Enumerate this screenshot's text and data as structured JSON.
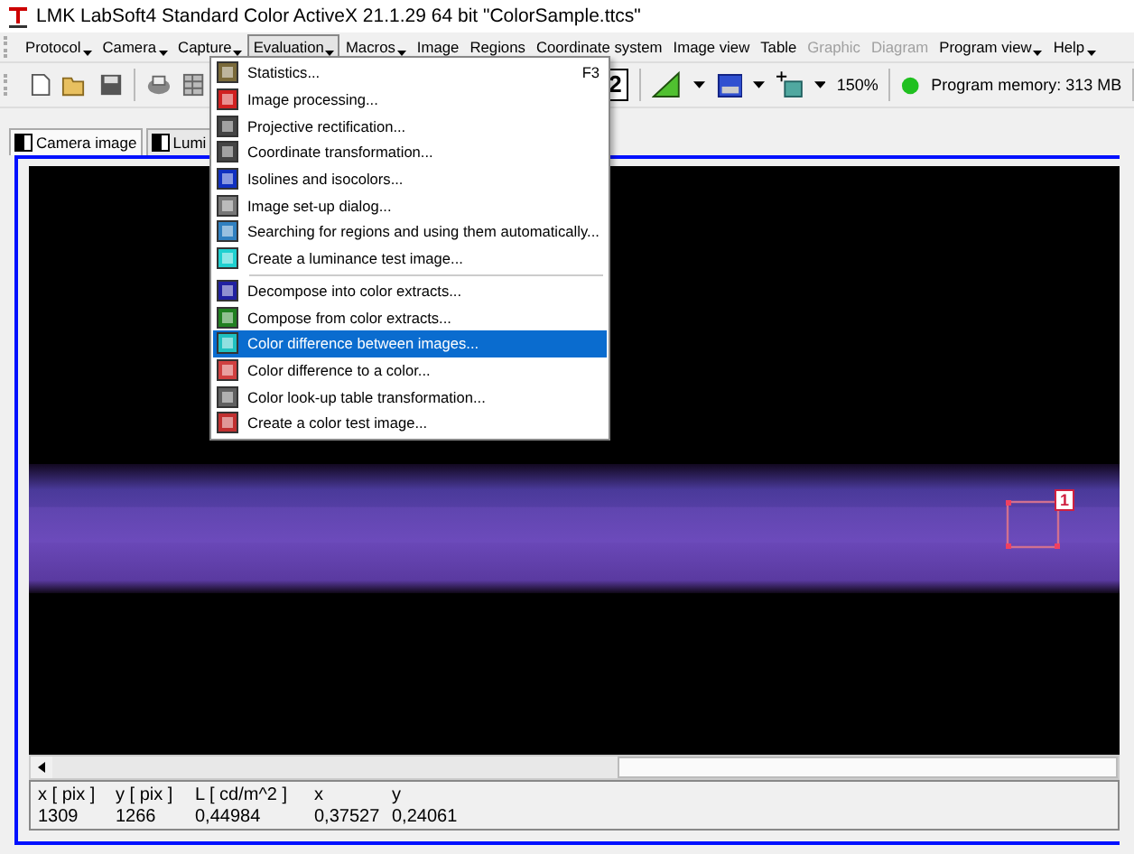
{
  "window": {
    "title": "LMK LabSoft4 Standard Color ActiveX  21.1.29 64 bit \"ColorSample.ttcs\""
  },
  "menu_bar": [
    {
      "label": "Protocol",
      "caret": true,
      "selected": false,
      "disabled": false
    },
    {
      "label": "Camera",
      "caret": true,
      "selected": false,
      "disabled": false
    },
    {
      "label": "Capture",
      "caret": true,
      "selected": false,
      "disabled": false
    },
    {
      "label": "Evaluation",
      "caret": true,
      "selected": true,
      "disabled": false
    },
    {
      "label": "Macros",
      "caret": true,
      "selected": false,
      "disabled": false
    },
    {
      "label": "Image",
      "caret": false,
      "selected": false,
      "disabled": false
    },
    {
      "label": "Regions",
      "caret": false,
      "selected": false,
      "disabled": false
    },
    {
      "label": "Coordinate system",
      "caret": false,
      "selected": false,
      "disabled": false
    },
    {
      "label": "Image view",
      "caret": false,
      "selected": false,
      "disabled": false
    },
    {
      "label": "Table",
      "caret": false,
      "selected": false,
      "disabled": false
    },
    {
      "label": "Graphic",
      "caret": false,
      "selected": false,
      "disabled": true
    },
    {
      "label": "Diagram",
      "caret": false,
      "selected": false,
      "disabled": true
    },
    {
      "label": "Program view",
      "caret": true,
      "selected": false,
      "disabled": false
    },
    {
      "label": "Help",
      "caret": true,
      "selected": false,
      "disabled": false
    }
  ],
  "evaluation_menu": [
    {
      "label": "Statistics...",
      "shortcut": "F3",
      "selected": false,
      "separator_before": false
    },
    {
      "label": "Image processing...",
      "selected": false,
      "separator_before": false
    },
    {
      "label": "Projective rectification...",
      "selected": false,
      "separator_before": false
    },
    {
      "label": "Coordinate transformation...",
      "selected": false,
      "separator_before": false
    },
    {
      "label": "Isolines and isocolors...",
      "selected": false,
      "separator_before": false
    },
    {
      "label": "Image set-up dialog...",
      "selected": false,
      "separator_before": false
    },
    {
      "label": "Searching for regions and using them automatically...",
      "selected": false,
      "separator_before": false
    },
    {
      "label": "Create a luminance test image...",
      "selected": false,
      "separator_before": false
    },
    {
      "label": "Decompose into color extracts...",
      "selected": false,
      "separator_before": true
    },
    {
      "label": "Compose from color extracts...",
      "selected": false,
      "separator_before": false
    },
    {
      "label": "Color difference between images...",
      "selected": true,
      "separator_before": false
    },
    {
      "label": "Color difference to a color...",
      "selected": false,
      "separator_before": false
    },
    {
      "label": "Color look-up table transformation...",
      "selected": false,
      "separator_before": false
    },
    {
      "label": "Create a color test image...",
      "selected": false,
      "separator_before": false
    }
  ],
  "toolbar": {
    "view_number": "2",
    "zoom": "150%",
    "memory": "Program memory: 313 MB"
  },
  "tabs": [
    {
      "label": "Camera image",
      "selected": true
    },
    {
      "label": "Lumi",
      "selected": false
    }
  ],
  "image": {
    "region_label": "1"
  },
  "info_table": {
    "columns": [
      "x [ pix ]",
      "y [ pix ]",
      "L [ cd/m^2 ]",
      "x",
      "y"
    ],
    "values": [
      "1309",
      "1266",
      "0,44984",
      "0,37527",
      "0,24061"
    ]
  }
}
